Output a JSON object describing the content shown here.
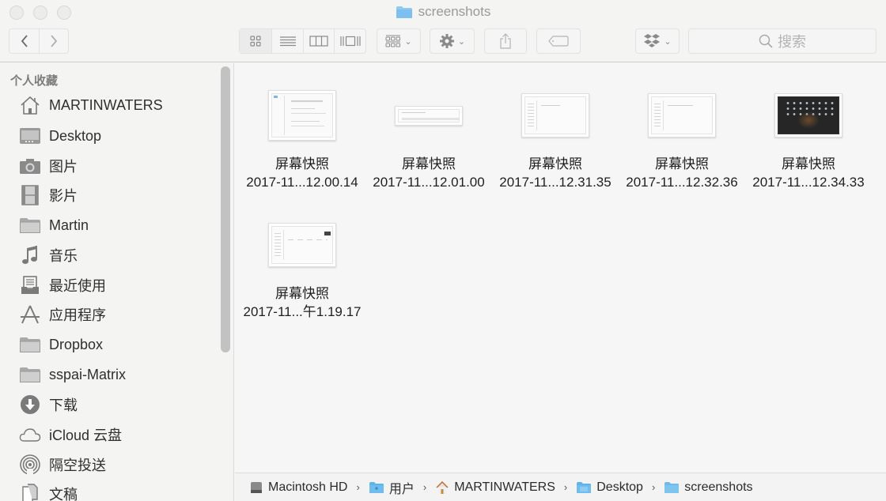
{
  "window": {
    "title": "screenshots",
    "title_icon": "folder-icon"
  },
  "toolbar": {
    "back_icon": "chevron-left-icon",
    "forward_icon": "chevron-right-icon",
    "view_modes": [
      "icon-view",
      "list-view",
      "column-view",
      "cover-flow-view"
    ],
    "active_view": "icon-view",
    "arrange_icon": "group-grid-icon",
    "action_icon": "gear-icon",
    "share_icon": "share-icon",
    "tag_icon": "tag-icon",
    "dropbox_icon": "dropbox-icon",
    "search_placeholder": "搜索"
  },
  "sidebar": {
    "section_title": "个人收藏",
    "items": [
      {
        "label": "MARTINWATERS",
        "icon": "home-icon"
      },
      {
        "label": "Desktop",
        "icon": "desktop-icon"
      },
      {
        "label": "图片",
        "icon": "camera-icon"
      },
      {
        "label": "影片",
        "icon": "film-icon"
      },
      {
        "label": "Martin",
        "icon": "folder-icon"
      },
      {
        "label": "音乐",
        "icon": "music-note-icon"
      },
      {
        "label": "最近使用",
        "icon": "recents-icon"
      },
      {
        "label": "应用程序",
        "icon": "applications-icon"
      },
      {
        "label": "Dropbox",
        "icon": "folder-icon"
      },
      {
        "label": "sspai-Matrix",
        "icon": "folder-icon"
      },
      {
        "label": "下载",
        "icon": "download-icon"
      },
      {
        "label": "iCloud 云盘",
        "icon": "cloud-icon"
      },
      {
        "label": "隔空投送",
        "icon": "airdrop-icon"
      },
      {
        "label": "文稿",
        "icon": "documents-icon"
      }
    ]
  },
  "files": [
    {
      "name": "屏幕快照",
      "date": "2017-11...12.00.14",
      "thumb": "document-light"
    },
    {
      "name": "屏幕快照",
      "date": "2017-11...12.01.00",
      "thumb": "strip-light"
    },
    {
      "name": "屏幕快照",
      "date": "2017-11...12.31.35",
      "thumb": "window-light"
    },
    {
      "name": "屏幕快照",
      "date": "2017-11...12.32.36",
      "thumb": "window-light"
    },
    {
      "name": "屏幕快照",
      "date": "2017-11...12.34.33",
      "thumb": "dark-launchpad"
    },
    {
      "name": "屏幕快照",
      "date": "2017-11...午1.19.17",
      "thumb": "window-light-dark-button"
    }
  ],
  "pathbar": [
    {
      "label": "Macintosh HD",
      "icon": "hard-drive-icon"
    },
    {
      "label": "用户",
      "icon": "users-folder-icon"
    },
    {
      "label": "MARTINWATERS",
      "icon": "home-icon"
    },
    {
      "label": "Desktop",
      "icon": "folder-icon"
    },
    {
      "label": "screenshots",
      "icon": "folder-icon"
    }
  ],
  "colors": {
    "folder_blue": "#6fb8ea",
    "icon_gray": "#8e8e8e",
    "text": "#2b2b2b"
  }
}
